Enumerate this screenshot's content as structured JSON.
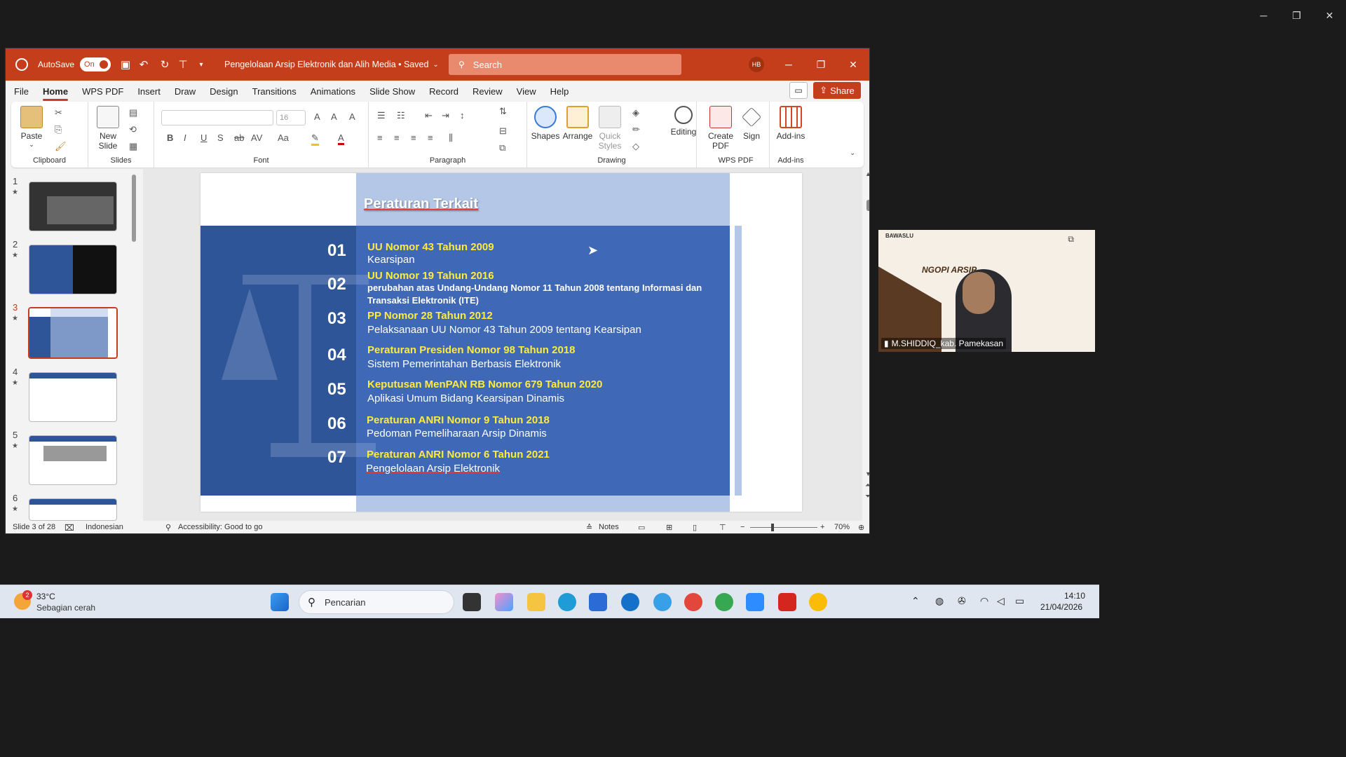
{
  "window": {
    "minimize": "─",
    "restore": "❐",
    "close": "✕"
  },
  "ppt": {
    "autosave_label": "AutoSave",
    "autosave_state": "On",
    "doc_title": "Pengelolaan Arsip Elektronik dan Alih Media • Saved",
    "search_placeholder": "Search",
    "avatar": "HB",
    "menu": [
      "File",
      "Home",
      "WPS PDF",
      "Insert",
      "Draw",
      "Design",
      "Transitions",
      "Animations",
      "Slide Show",
      "Record",
      "Review",
      "View",
      "Help"
    ],
    "share": "Share",
    "ribbon": {
      "paste": "Paste",
      "new_slide": "New\nSlide",
      "font_size": "16",
      "groups": {
        "clipboard": "Clipboard",
        "slides": "Slides",
        "font": "Font",
        "paragraph": "Paragraph",
        "drawing": "Drawing",
        "wps_pdf": "WPS PDF",
        "add_ins": "Add-ins"
      },
      "shapes": "Shapes",
      "arrange": "Arrange",
      "quick_styles": "Quick\nStyles",
      "editing": "Editing",
      "create_pdf": "Create\nPDF",
      "sign": "Sign",
      "addins_btn": "Add-ins"
    },
    "thumbs": [
      "1",
      "2",
      "3",
      "4",
      "5",
      "6"
    ],
    "slide": {
      "title": "Peraturan Terkait",
      "items": [
        {
          "num": "01",
          "title": "UU Nomor 43 Tahun 2009",
          "desc": "Kearsipan"
        },
        {
          "num": "02",
          "title": "UU Nomor 19 Tahun 2016",
          "desc": "perubahan atas Undang-Undang Nomor 11 Tahun 2008 tentang Informasi dan Transaksi Elektronik (ITE)"
        },
        {
          "num": "03",
          "title": "PP Nomor 28 Tahun 2012",
          "desc": "Pelaksanaan UU Nomor 43 Tahun 2009 tentang Kearsipan"
        },
        {
          "num": "04",
          "title": "Peraturan Presiden Nomor 98 Tahun 2018",
          "desc": "Sistem Pemerintahan Berbasis Elektronik"
        },
        {
          "num": "05",
          "title": "Keputusan MenPAN RB Nomor 679 Tahun 2020",
          "desc": "Aplikasi Umum Bidang Kearsipan Dinamis"
        },
        {
          "num": "06",
          "title": "Peraturan ANRI Nomor 9 Tahun 2018",
          "desc": "Pedoman Pemeliharaan Arsip Dinamis"
        },
        {
          "num": "07",
          "title": "Peraturan ANRI Nomor 6 Tahun 2021",
          "desc": "Pengelolaan Arsip Elektronik"
        }
      ]
    },
    "status": {
      "slide": "Slide 3 of 28",
      "language": "Indonesian",
      "accessibility": "Accessibility: Good to go",
      "notes": "Notes",
      "zoom": "70%"
    }
  },
  "video": {
    "name": "M.SHIDDIQ_kab. Pamekasan",
    "poster_title": "NGOPI ARSIP",
    "poster_org": "BAWASLU"
  },
  "taskbar": {
    "temp": "33°C",
    "weather": "Sebagian cerah",
    "weather_badge": "2",
    "search": "Pencarian",
    "time": "14:10",
    "date": "21/04/2026"
  },
  "colors": {
    "ppt_red": "#c43e1c",
    "slide_dark": "#2e5597",
    "slide_mid": "#3f69b6",
    "slide_light": "#b4c7e7",
    "yellow": "#ffeb3b"
  }
}
